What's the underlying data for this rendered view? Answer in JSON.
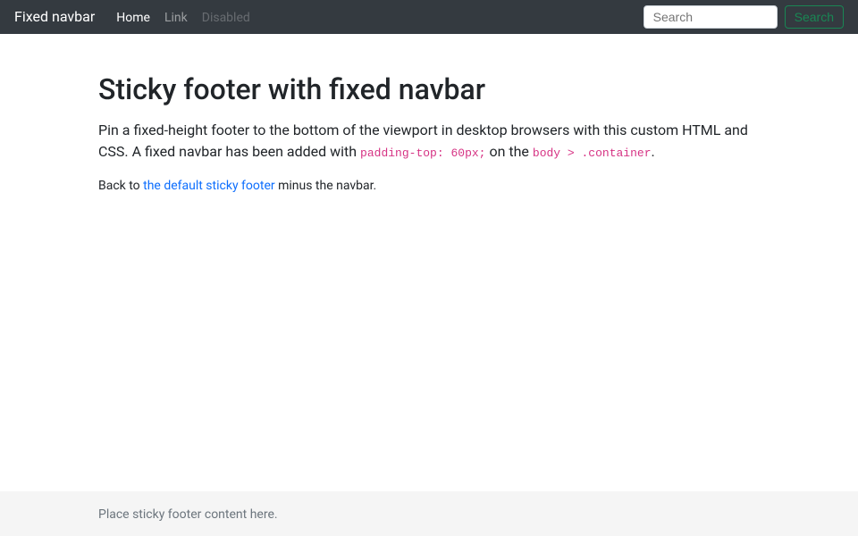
{
  "navbar": {
    "brand": "Fixed navbar",
    "items": [
      {
        "label": "Home",
        "state": "active"
      },
      {
        "label": "Link",
        "state": "normal"
      },
      {
        "label": "Disabled",
        "state": "disabled"
      }
    ],
    "search_placeholder": "Search",
    "search_button": "Search"
  },
  "main": {
    "heading": "Sticky footer with fixed navbar",
    "lead_part1": "Pin a fixed-height footer to the bottom of the viewport in desktop browsers with this custom HTML and CSS. A fixed navbar has been added with ",
    "lead_code1": "padding-top: 60px;",
    "lead_part2": " on the ",
    "lead_code2": "body > .container",
    "lead_part3": ".",
    "back_prefix": "Back to ",
    "back_link": "the default sticky footer",
    "back_suffix": " minus the navbar."
  },
  "footer": {
    "text": "Place sticky footer content here."
  }
}
